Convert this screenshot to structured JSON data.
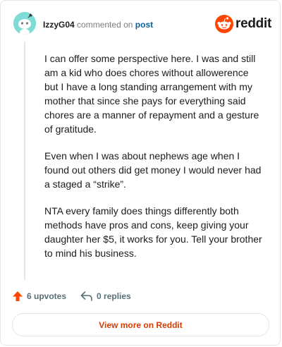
{
  "header": {
    "username": "IzzyG04",
    "action": "commented on",
    "post_link": "post",
    "logo_text": "reddit",
    "logo_icon": "snoo-icon",
    "avatar_icon": "snoo-avatar"
  },
  "comment": {
    "paragraphs": [
      "I can offer some perspective here. I was and still am a kid who does chores without allowerence but I have a long standing arrangement with my mother that since she pays for everything said chores are a manner of repayment and a gesture of gratitude.",
      "Even when I was about nephews age when I found out others did get money I would never had a staged a “strike”.",
      "NTA every family does things differently both methods have pros and cons, keep giving your daughter her $5, it works for you. Tell your brother to mind his business."
    ]
  },
  "footer": {
    "upvotes": "6 upvotes",
    "replies": "0 replies",
    "upvote_icon": "upvote-arrow-icon",
    "reply_icon": "reply-icon"
  },
  "cta": {
    "label": "View more on Reddit"
  },
  "colors": {
    "accent": "#ff4500",
    "link": "#0a5f9e",
    "cta_text": "#d93a00",
    "avatar_bg": "#7edbd6"
  }
}
